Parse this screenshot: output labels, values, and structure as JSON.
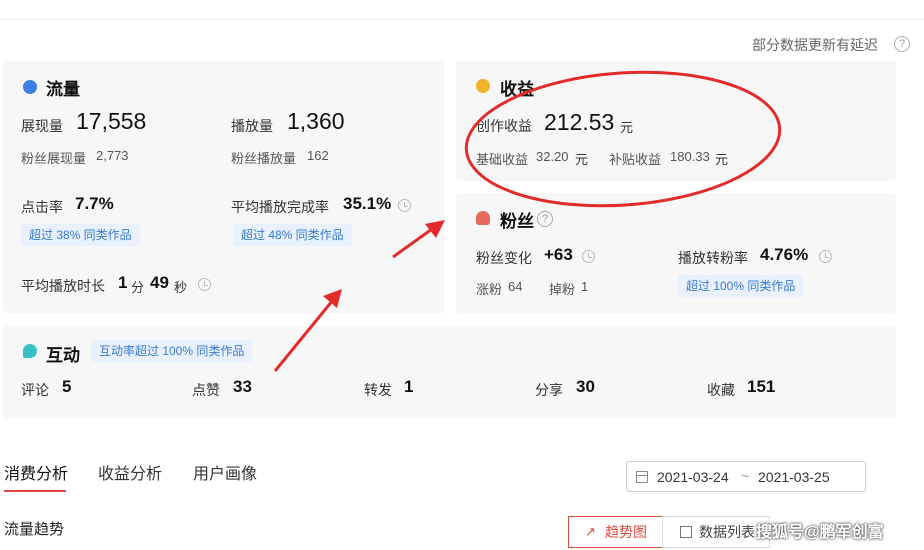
{
  "notice": "部分数据更新有延迟",
  "traffic": {
    "title": "流量",
    "impressions_label": "展现量",
    "impressions_value": "17,558",
    "plays_label": "播放量",
    "plays_value": "1,360",
    "fan_impressions_label": "粉丝展现量",
    "fan_impressions_value": "2,773",
    "fan_plays_label": "粉丝播放量",
    "fan_plays_value": "162",
    "ctr_label": "点击率",
    "ctr_value": "7.7%",
    "ctr_badge": "超过 38% 同类作品",
    "completion_label": "平均播放完成率",
    "completion_value": "35.1%",
    "completion_badge": "超过 48% 同类作品",
    "duration_label": "平均播放时长",
    "duration_min": "1",
    "duration_min_unit": "分",
    "duration_sec": "49",
    "duration_sec_unit": "秒"
  },
  "revenue": {
    "title": "收益",
    "creation_label": "创作收益",
    "creation_value": "212.53",
    "unit": "元",
    "basic_label": "基础收益",
    "basic_value": "32.20",
    "subsidy_label": "补贴收益",
    "subsidy_value": "180.33"
  },
  "fans": {
    "title": "粉丝",
    "change_label": "粉丝变化",
    "change_value": "+63",
    "conversion_label": "播放转粉率",
    "conversion_value": "4.76%",
    "conversion_badge": "超过 100% 同类作品",
    "gain_label": "涨粉",
    "gain_value": "64",
    "loss_label": "掉粉",
    "loss_value": "1"
  },
  "interaction": {
    "title": "互动",
    "badge": "互动率超过 100% 同类作品",
    "comments_label": "评论",
    "comments_value": "5",
    "likes_label": "点赞",
    "likes_value": "33",
    "reposts_label": "转发",
    "reposts_value": "1",
    "shares_label": "分享",
    "shares_value": "30",
    "favorites_label": "收藏",
    "favorites_value": "151"
  },
  "tabs": [
    "消费分析",
    "收益分析",
    "用户画像"
  ],
  "date_range": {
    "start": "2021-03-24",
    "separator": "~",
    "end": "2021-03-25"
  },
  "section_title": "流量趋势",
  "view_buttons": {
    "trend": "趋势图",
    "table": "数据列表"
  },
  "watermark": "搜狐号@鹏军创富",
  "colors": {
    "accent": "#e0473f",
    "badge_text": "#3a7bd5",
    "annotation": "#e32b2b"
  }
}
